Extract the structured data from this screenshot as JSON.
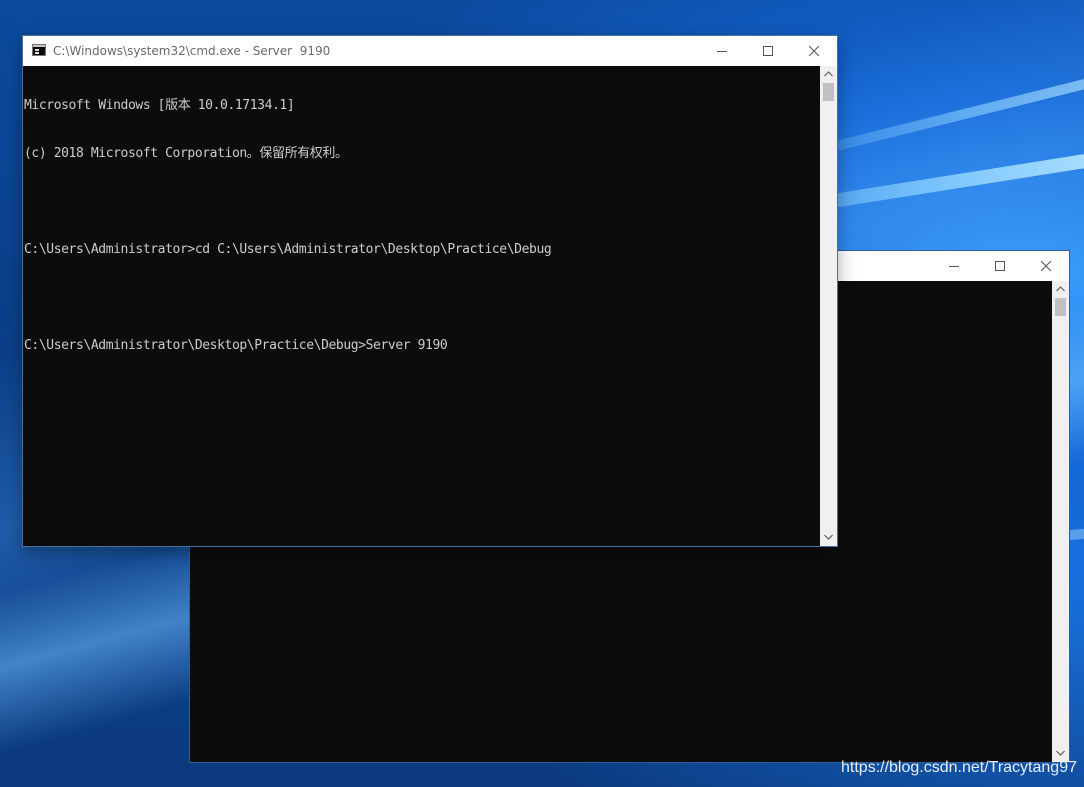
{
  "desktop": {
    "watermark": "https://blog.csdn.net/Tracytang97"
  },
  "front_window": {
    "title": "C:\\Windows\\system32\\cmd.exe - Server  9190",
    "icon": "console-app-icon",
    "console_lines": [
      "Microsoft Windows [版本 10.0.17134.1]",
      "(c) 2018 Microsoft Corporation。保留所有权利。",
      "",
      "C:\\Users\\Administrator>cd C:\\Users\\Administrator\\Desktop\\Practice\\Debug",
      "",
      "C:\\Users\\Administrator\\Desktop\\Practice\\Debug>Server 9190"
    ]
  },
  "back_window": {
    "title": ""
  },
  "colors": {
    "console_bg": "#0c0c0c",
    "console_text": "#cccccc",
    "titlebar_bg": "#ffffff",
    "desktop_accent": "#1467d6"
  }
}
